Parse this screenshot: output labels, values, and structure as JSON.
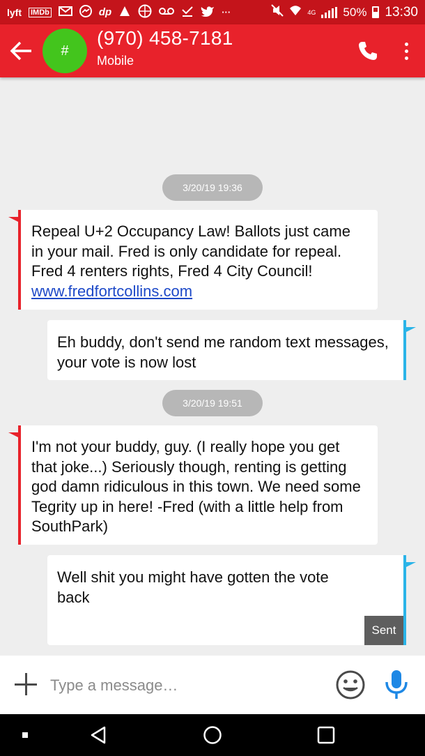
{
  "status_bar": {
    "icons": [
      "lyft",
      "IMDb",
      "gmail",
      "messenger",
      "dp",
      "app",
      "basketball",
      "voicemail",
      "download-check",
      "twitter",
      "more"
    ],
    "network": "4G",
    "battery": "50%",
    "time": "13:30"
  },
  "header": {
    "avatar_text": "#",
    "contact_number": "(970) 458-7181",
    "contact_type": "Mobile"
  },
  "conversation": {
    "timestamps": [
      "3/20/19 19:36",
      "3/20/19 19:51"
    ],
    "messages": [
      {
        "direction": "incoming",
        "text": "Repeal U+2 Occupancy Law! Ballots just came in your mail. Fred is only candidate for repeal. Fred 4 renters rights, Fred 4 City Council!",
        "link": "www.fredfortcollins.com"
      },
      {
        "direction": "outgoing",
        "text": "Eh buddy, don't send me random text messages, your vote is now lost"
      },
      {
        "direction": "incoming",
        "text": "I'm not your buddy, guy. (I really hope you get that joke...) Seriously though, renting is getting god damn ridiculous in this town. We need some Tegrity up in here!  -Fred (with a little help from SouthPark)"
      },
      {
        "direction": "outgoing",
        "text": "Well shit you might have gotten the vote back",
        "status": "Sent"
      }
    ]
  },
  "compose": {
    "placeholder": "Type a message…"
  },
  "colors": {
    "status_bar": "#c4141b",
    "app_bar": "#e8222b",
    "avatar": "#43c51d",
    "incoming_accent": "#e8222b",
    "outgoing_accent": "#2ab4e8",
    "mic": "#1e88e5",
    "link": "#1d49c8"
  }
}
